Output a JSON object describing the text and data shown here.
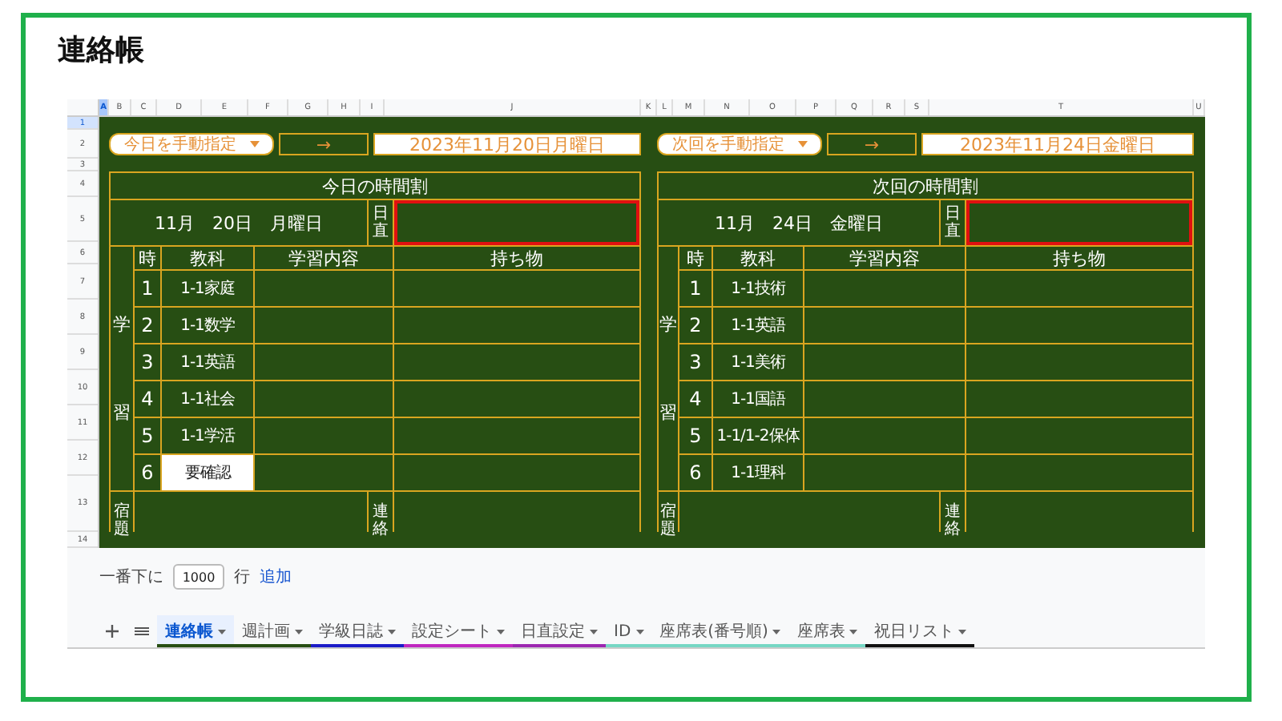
{
  "page_title": "連絡帳",
  "sheet": {
    "columns": [
      {
        "label": "A",
        "selected": true
      },
      {
        "label": "B",
        "selected": false
      },
      {
        "label": "C",
        "selected": false
      },
      {
        "label": "D",
        "selected": false
      },
      {
        "label": "E",
        "selected": false
      },
      {
        "label": "F",
        "selected": false
      },
      {
        "label": "G",
        "selected": false
      },
      {
        "label": "H",
        "selected": false
      },
      {
        "label": "I",
        "selected": false
      },
      {
        "label": "J",
        "selected": false
      },
      {
        "label": "K",
        "selected": false
      },
      {
        "label": "L",
        "selected": false
      },
      {
        "label": "M",
        "selected": false
      },
      {
        "label": "N",
        "selected": false
      },
      {
        "label": "O",
        "selected": false
      },
      {
        "label": "P",
        "selected": false
      },
      {
        "label": "Q",
        "selected": false
      },
      {
        "label": "R",
        "selected": false
      },
      {
        "label": "S",
        "selected": false
      },
      {
        "label": "T",
        "selected": false
      },
      {
        "label": "U",
        "selected": false
      }
    ],
    "rows": [
      {
        "label": "1",
        "selected": true
      },
      {
        "label": "2",
        "selected": false
      },
      {
        "label": "3",
        "selected": false
      },
      {
        "label": "4",
        "selected": false
      },
      {
        "label": "5",
        "selected": false
      },
      {
        "label": "6",
        "selected": false
      },
      {
        "label": "7",
        "selected": false
      },
      {
        "label": "8",
        "selected": false
      },
      {
        "label": "9",
        "selected": false
      },
      {
        "label": "10",
        "selected": false
      },
      {
        "label": "11",
        "selected": false
      },
      {
        "label": "12",
        "selected": false
      },
      {
        "label": "13",
        "selected": false
      },
      {
        "label": "14",
        "selected": false
      }
    ]
  },
  "panels": [
    {
      "dropdown": "今日を手動指定",
      "arrow": "→",
      "date": "2023年11月20日月曜日",
      "title": "今日の時間割",
      "date_line": "11月　20日　月曜日",
      "duty_label": "日直",
      "duty_highlighted": true,
      "section_label": "学習",
      "headers": [
        "時",
        "教科",
        "学習内容",
        "持ち物"
      ],
      "homework_label": "宿題",
      "contact_label": "連絡",
      "periods": [
        {
          "number": "1",
          "subject": "1-1家庭",
          "needs_check": false
        },
        {
          "number": "2",
          "subject": "1-1数学",
          "needs_check": false
        },
        {
          "number": "3",
          "subject": "1-1英語",
          "needs_check": false
        },
        {
          "number": "4",
          "subject": "1-1社会",
          "needs_check": false
        },
        {
          "number": "5",
          "subject": "1-1学活",
          "needs_check": false
        },
        {
          "number": "6",
          "subject": "要確認",
          "needs_check": true
        }
      ]
    },
    {
      "dropdown": "次回を手動指定",
      "arrow": "→",
      "date": "2023年11月24日金曜日",
      "title": "次回の時間割",
      "date_line": "11月　24日　金曜日",
      "duty_label": "日直",
      "duty_highlighted": true,
      "section_label": "学習",
      "headers": [
        "時",
        "教科",
        "学習内容",
        "持ち物"
      ],
      "homework_label": "宿題",
      "contact_label": "連絡",
      "periods": [
        {
          "number": "1",
          "subject": "1-1技術",
          "needs_check": false
        },
        {
          "number": "2",
          "subject": "1-1英語",
          "needs_check": false
        },
        {
          "number": "3",
          "subject": "1-1美術",
          "needs_check": false
        },
        {
          "number": "4",
          "subject": "1-1国語",
          "needs_check": false
        },
        {
          "number": "5",
          "subject": "1-1/1-2保体",
          "needs_check": false
        },
        {
          "number": "6",
          "subject": "1-1理科",
          "needs_check": false
        }
      ]
    }
  ],
  "add_rows": {
    "prefix": "一番下に",
    "value": "1000",
    "suffix": "行",
    "button": "追加"
  },
  "tabs": [
    {
      "label": "連絡帳",
      "selected": true,
      "color": "#274e13"
    },
    {
      "label": "週計画",
      "selected": false,
      "color": "#274e13"
    },
    {
      "label": "学級日誌",
      "selected": false,
      "color": "#1c1cc8"
    },
    {
      "label": "設定シート",
      "selected": false,
      "color": "#c027c0"
    },
    {
      "label": "日直設定",
      "selected": false,
      "color": "#9c27b0"
    },
    {
      "label": "ID",
      "selected": false,
      "color": "#76d7c4"
    },
    {
      "label": "座席表(番号順)",
      "selected": false,
      "color": "#76d7c4"
    },
    {
      "label": "座席表",
      "selected": false,
      "color": "#76d7c4"
    },
    {
      "label": "祝日リスト",
      "selected": false,
      "color": "#111111"
    }
  ]
}
